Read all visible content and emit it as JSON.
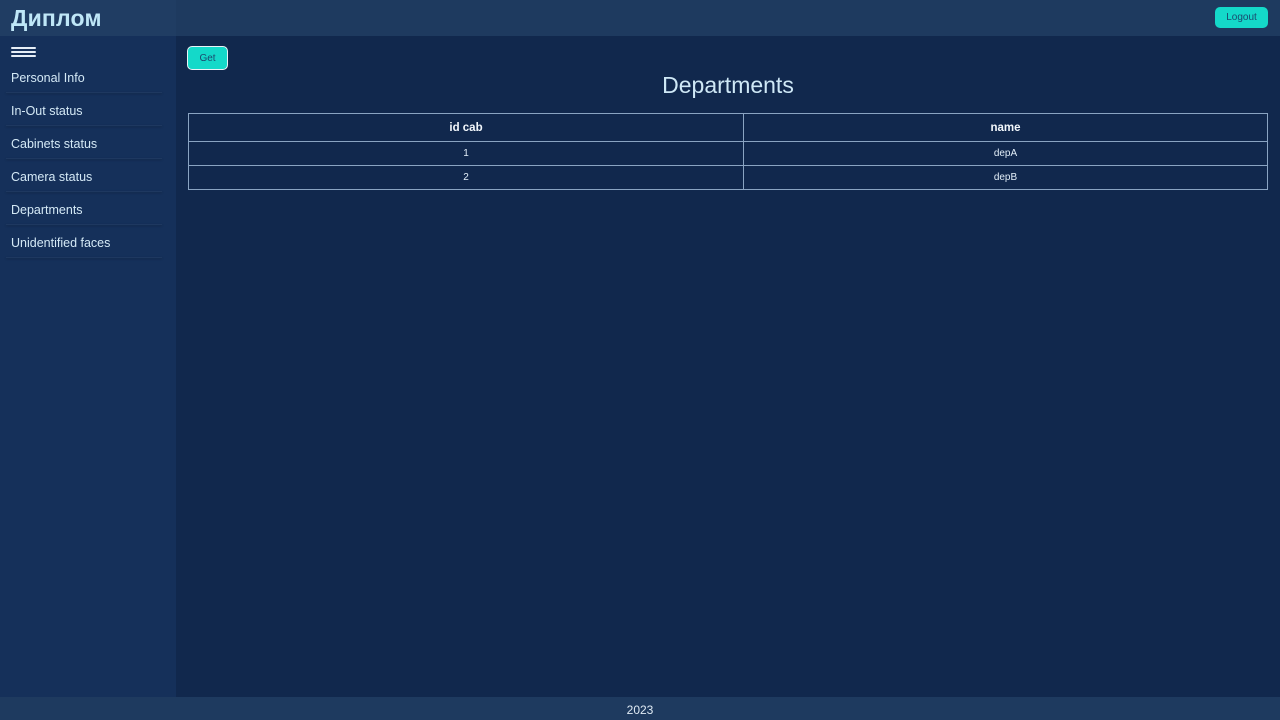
{
  "header": {
    "brand": "Диплом",
    "logout_label": "Logout"
  },
  "sidebar": {
    "menu_icon": "hamburger-menu-icon",
    "items": [
      {
        "label": "Personal Info"
      },
      {
        "label": "In-Out status"
      },
      {
        "label": "Cabinets status"
      },
      {
        "label": "Camera status"
      },
      {
        "label": "Departments"
      },
      {
        "label": "Unidentified faces"
      }
    ]
  },
  "main": {
    "get_label": "Get",
    "title": "Departments",
    "table": {
      "columns": [
        "id cab",
        "name"
      ],
      "rows": [
        [
          "1",
          "depA"
        ],
        [
          "2",
          "depB"
        ]
      ]
    }
  },
  "footer": {
    "text": "2023"
  },
  "colors": {
    "accent": "#14d9c9",
    "background": "#11284d",
    "header": "#1e3a5f",
    "sidebar": "#15305a"
  }
}
